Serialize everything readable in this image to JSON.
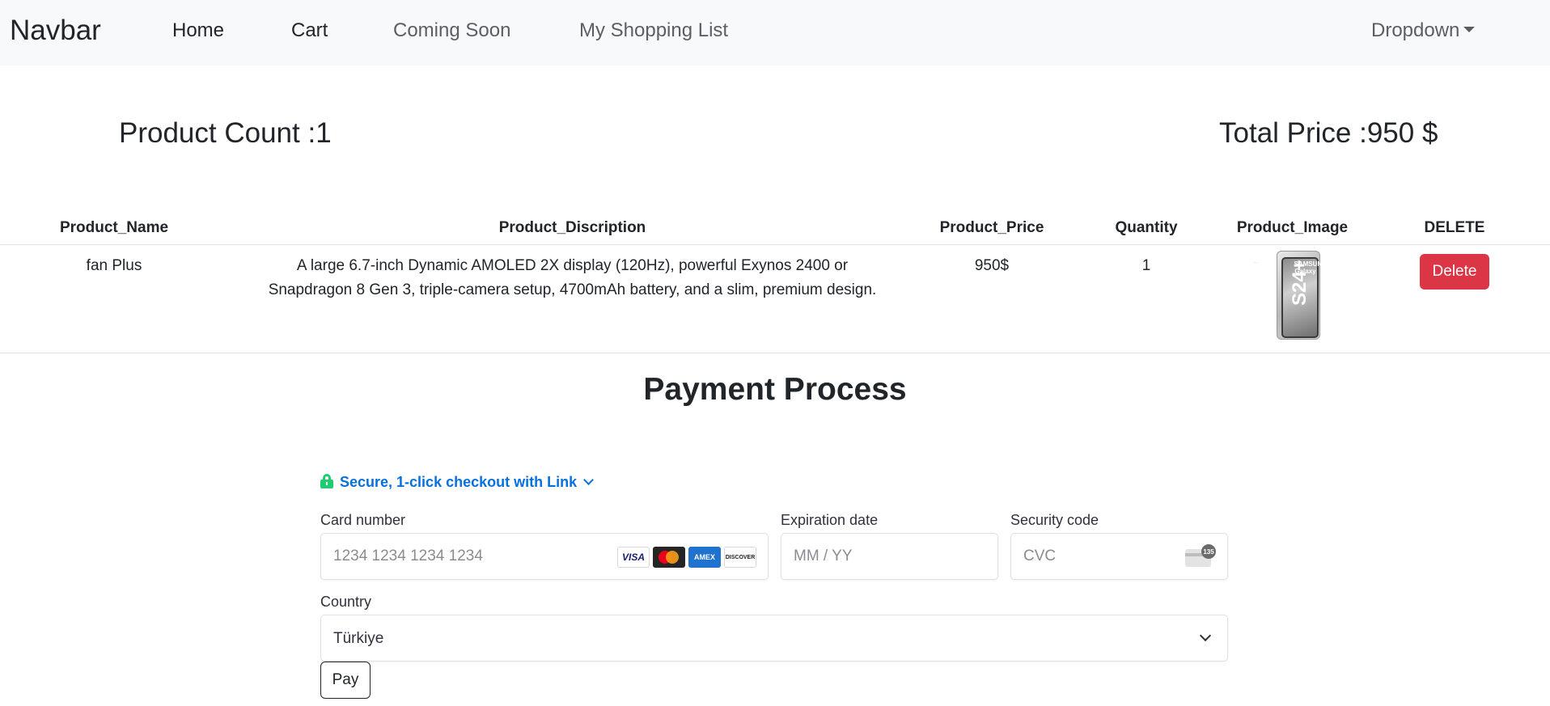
{
  "navbar": {
    "brand": "Navbar",
    "links": [
      "Home",
      "Cart",
      "Coming Soon",
      "My Shopping List"
    ],
    "dropdown_label": "Dropdown"
  },
  "summary": {
    "product_count": "Product Count :1",
    "total_price": "Total Price :950 $"
  },
  "table": {
    "headers": [
      "Product_Name",
      "Product_Discription",
      "Product_Price",
      "Quantity",
      "Product_Image",
      "DELETE"
    ],
    "rows": [
      {
        "name": "fan Plus",
        "description": "A large 6.7-inch Dynamic AMOLED 2X display (120Hz), powerful Exynos 2400 or Snapdragon 8 Gen 3, triple-camera setup, 4700mAh battery, and a slim, premium design.",
        "price": "950$",
        "quantity": "1",
        "image": {
          "brand_text": "SAMSUNG Galaxy",
          "model_text": "S24+"
        },
        "delete_label": "Delete"
      }
    ]
  },
  "payment": {
    "title": "Payment Process",
    "link_text": "Secure, 1-click checkout with Link",
    "card_number": {
      "label": "Card number",
      "placeholder": "1234 1234 1234 1234",
      "brands": [
        "VISA",
        "mastercard",
        "AMEX",
        "DISCOVER"
      ]
    },
    "expiration": {
      "label": "Expiration date",
      "placeholder": "MM / YY"
    },
    "security_code": {
      "label": "Security code",
      "placeholder": "CVC",
      "icon_number": "135"
    },
    "country": {
      "label": "Country",
      "value": "Türkiye"
    },
    "pay_label": "Pay"
  },
  "colors": {
    "navbar_bg": "#f8f9fa",
    "delete_button": "#dc3545",
    "link_blue": "#0570de",
    "lock_green": "#1fcc6f"
  }
}
